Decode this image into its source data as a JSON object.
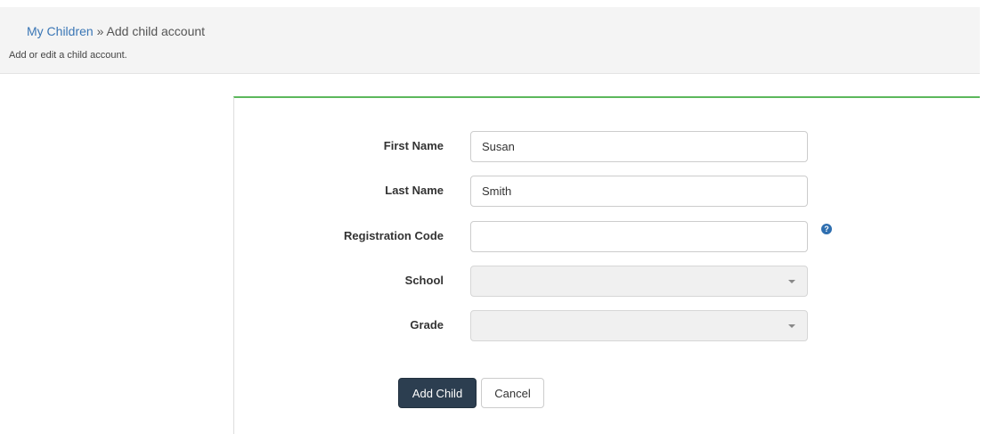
{
  "header": {
    "breadcrumb_link": "My Children",
    "breadcrumb_separator": "»",
    "breadcrumb_current": "Add child account",
    "subtitle": "Add or edit a child account."
  },
  "form": {
    "first_name": {
      "label": "First Name",
      "value": "Susan"
    },
    "last_name": {
      "label": "Last Name",
      "value": "Smith"
    },
    "registration_code": {
      "label": "Registration Code",
      "value": "",
      "help_icon": "question-circle"
    },
    "school": {
      "label": "School",
      "selected": ""
    },
    "grade": {
      "label": "Grade",
      "selected": ""
    },
    "submit_label": "Add Child",
    "cancel_label": "Cancel"
  },
  "colors": {
    "accent_border": "#5cb85c",
    "primary_button": "#2c3e50",
    "link": "#3a76b5"
  }
}
